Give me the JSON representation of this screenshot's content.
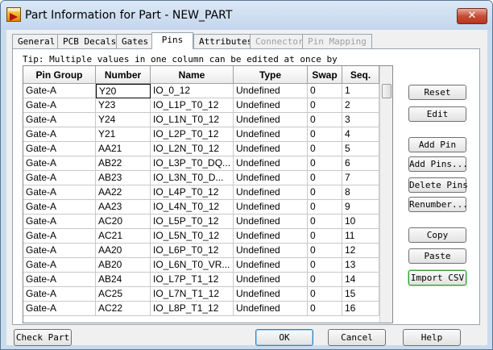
{
  "window": {
    "title": "Part Information for Part - NEW_PART",
    "app_icon_text": "PADS",
    "close_glyph": "✕"
  },
  "tabs": [
    {
      "label": "General",
      "state": "normal"
    },
    {
      "label": "PCB Decals",
      "state": "normal"
    },
    {
      "label": "Gates",
      "state": "normal"
    },
    {
      "label": "Pins",
      "state": "active"
    },
    {
      "label": "Attributes",
      "state": "normal"
    },
    {
      "label": "Connector",
      "state": "disabled"
    },
    {
      "label": "Pin Mapping",
      "state": "disabled"
    }
  ],
  "tip": "Tip: Multiple values in one column can be edited at once by",
  "grid": {
    "columns": [
      "Pin Group",
      "Number",
      "Name",
      "Type",
      "Swap",
      "Seq."
    ],
    "rows": [
      [
        "Gate-A",
        "Y20",
        "IO_0_12",
        "Undefined",
        "0",
        "1"
      ],
      [
        "Gate-A",
        "Y23",
        "IO_L1P_T0_12",
        "Undefined",
        "0",
        "2"
      ],
      [
        "Gate-A",
        "Y24",
        "IO_L1N_T0_12",
        "Undefined",
        "0",
        "3"
      ],
      [
        "Gate-A",
        "Y21",
        "IO_L2P_T0_12",
        "Undefined",
        "0",
        "4"
      ],
      [
        "Gate-A",
        "AA21",
        "IO_L2N_T0_12",
        "Undefined",
        "0",
        "5"
      ],
      [
        "Gate-A",
        "AB22",
        "IO_L3P_T0_DQ...",
        "Undefined",
        "0",
        "6"
      ],
      [
        "Gate-A",
        "AB23",
        "IO_L3N_T0_D...",
        "Undefined",
        "0",
        "7"
      ],
      [
        "Gate-A",
        "AA22",
        "IO_L4P_T0_12",
        "Undefined",
        "0",
        "8"
      ],
      [
        "Gate-A",
        "AA23",
        "IO_L4N_T0_12",
        "Undefined",
        "0",
        "9"
      ],
      [
        "Gate-A",
        "AC20",
        "IO_L5P_T0_12",
        "Undefined",
        "0",
        "10"
      ],
      [
        "Gate-A",
        "AC21",
        "IO_L5N_T0_12",
        "Undefined",
        "0",
        "11"
      ],
      [
        "Gate-A",
        "AA20",
        "IO_L6P_T0_12",
        "Undefined",
        "0",
        "12"
      ],
      [
        "Gate-A",
        "AB20",
        "IO_L6N_T0_VR...",
        "Undefined",
        "0",
        "13"
      ],
      [
        "Gate-A",
        "AB24",
        "IO_L7P_T1_12",
        "Undefined",
        "0",
        "14"
      ],
      [
        "Gate-A",
        "AC25",
        "IO_L7N_T1_12",
        "Undefined",
        "0",
        "15"
      ],
      [
        "Gate-A",
        "AC22",
        "IO_L8P_T1_12",
        "Undefined",
        "0",
        "16"
      ]
    ],
    "selected_cell": {
      "row": 0,
      "col": 1
    }
  },
  "side_buttons": {
    "reset": "Reset",
    "edit": "Edit",
    "add_pin": "Add Pin",
    "add_pins": "Add Pins...",
    "delete_pins": "Delete Pins",
    "renumber": "Renumber...",
    "copy": "Copy",
    "paste": "Paste",
    "import_csv": "Import CSV"
  },
  "bottom_buttons": {
    "check_part": "Check Part",
    "ok": "OK",
    "cancel": "Cancel",
    "help": "Help"
  },
  "colors": {
    "title_bar": "#c9dbee",
    "close_button": "#c74d36",
    "dialog_bg": "#f0f0f0",
    "import_highlight": "#3a9a3a"
  }
}
